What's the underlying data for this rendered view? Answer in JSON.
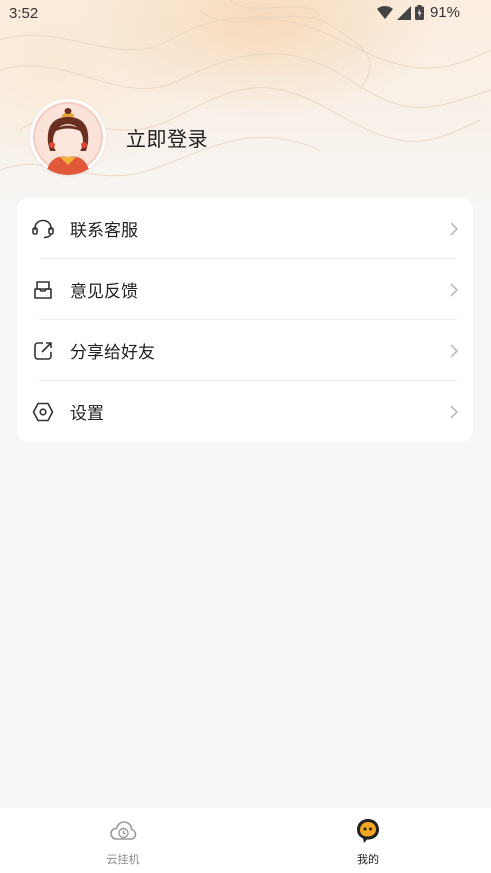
{
  "status_bar": {
    "time": "3:52",
    "battery": "91%"
  },
  "profile": {
    "login_label": "立即登录"
  },
  "menu": {
    "items": [
      {
        "label": "联系客服",
        "icon": "headset-icon"
      },
      {
        "label": "意见反馈",
        "icon": "feedback-icon"
      },
      {
        "label": "分享给好友",
        "icon": "share-icon"
      },
      {
        "label": "设置",
        "icon": "settings-icon"
      }
    ]
  },
  "tabbar": {
    "tabs": [
      {
        "label": "云挂机",
        "icon": "cloud-clock-icon",
        "active": false
      },
      {
        "label": "我的",
        "icon": "mascot-icon",
        "active": true
      }
    ]
  },
  "colors": {
    "active": "#222222",
    "inactive": "#8a8a8a",
    "accent": "#f5a623"
  }
}
